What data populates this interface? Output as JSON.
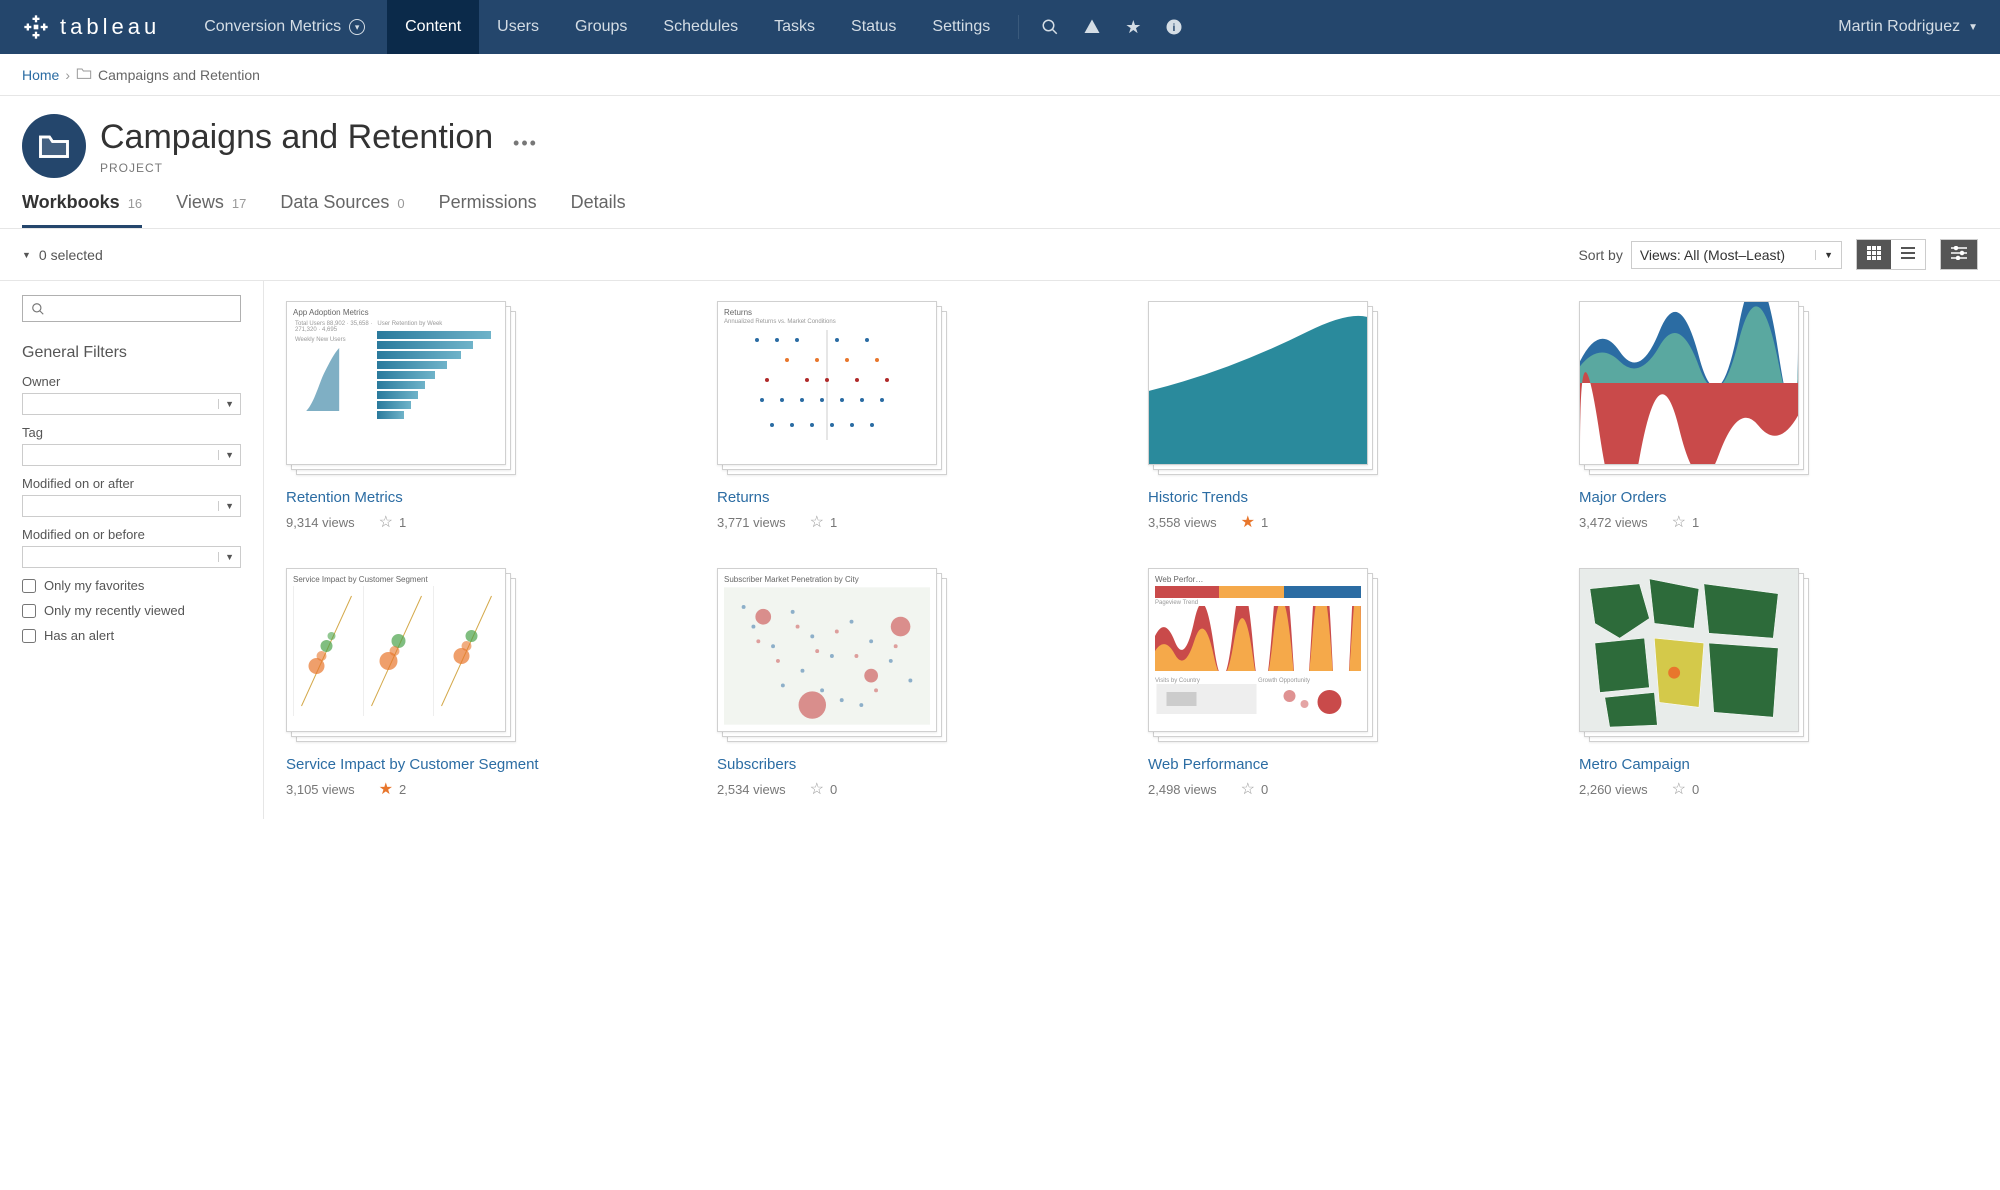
{
  "brand": "tableau",
  "site_selector": "Conversion Metrics",
  "nav": [
    "Content",
    "Users",
    "Groups",
    "Schedules",
    "Tasks",
    "Status",
    "Settings"
  ],
  "active_nav": "Content",
  "user": "Martin Rodriguez",
  "breadcrumb": {
    "home": "Home",
    "current": "Campaigns and Retention"
  },
  "project": {
    "title": "Campaigns and Retention",
    "subtitle": "PROJECT"
  },
  "tabs": [
    {
      "label": "Workbooks",
      "count": "16",
      "active": true
    },
    {
      "label": "Views",
      "count": "17"
    },
    {
      "label": "Data Sources",
      "count": "0"
    },
    {
      "label": "Permissions",
      "count": ""
    },
    {
      "label": "Details",
      "count": ""
    }
  ],
  "selection": "0 selected",
  "sort": {
    "label": "Sort by",
    "value": "Views: All (Most–Least)"
  },
  "filters": {
    "heading": "General Filters",
    "labels": {
      "owner": "Owner",
      "tag": "Tag",
      "mod_after": "Modified on or after",
      "mod_before": "Modified on or before",
      "only_fav": "Only my favorites",
      "only_recent": "Only my recently viewed",
      "has_alert": "Has an alert"
    }
  },
  "workbooks": [
    {
      "title": "Retention Metrics",
      "views": "9,314 views",
      "starred": false,
      "count": "1"
    },
    {
      "title": "Returns",
      "views": "3,771 views",
      "starred": false,
      "count": "1"
    },
    {
      "title": "Historic Trends",
      "views": "3,558 views",
      "starred": true,
      "count": "1"
    },
    {
      "title": "Major Orders",
      "views": "3,472 views",
      "starred": false,
      "count": "1"
    },
    {
      "title": "Service Impact by Customer Segment",
      "views": "3,105 views",
      "starred": true,
      "count": "2"
    },
    {
      "title": "Subscribers",
      "views": "2,534 views",
      "starred": false,
      "count": "0"
    },
    {
      "title": "Web Performance",
      "views": "2,498 views",
      "starred": false,
      "count": "0"
    },
    {
      "title": "Metro Campaign",
      "views": "2,260 views",
      "starred": false,
      "count": "0"
    }
  ]
}
